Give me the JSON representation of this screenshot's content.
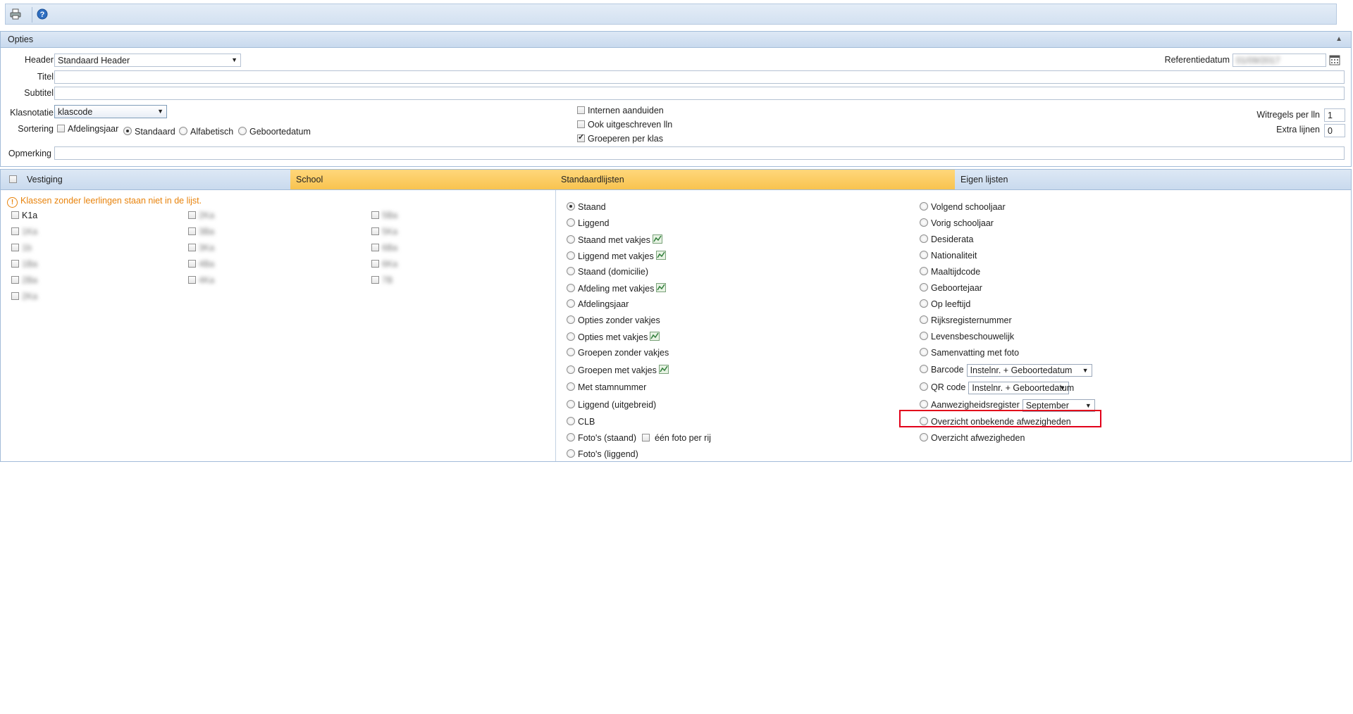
{
  "toolbar": {
    "print_icon": "printer-icon",
    "help_icon": "help-icon"
  },
  "opties": {
    "title": "Opties",
    "collapse_icon": "chevron-up-icon",
    "header_label": "Header",
    "header_value": "Standaard Header",
    "referentiedatum_label": "Referentiedatum",
    "referentiedatum_value": "01/09/2017",
    "titel_label": "Titel",
    "subtitel_label": "Subtitel",
    "klasnotatie_label": "Klasnotatie",
    "klasnotatie_value": "klascode",
    "sortering_label": "Sortering",
    "sort_afdelingsjaar": "Afdelingsjaar",
    "sort_options": [
      "Standaard",
      "Alfabetisch",
      "Geboortedatum"
    ],
    "sort_selected": "Standaard",
    "checks": [
      {
        "label": "Internen aanduiden",
        "checked": false
      },
      {
        "label": "Ook uitgeschreven lln",
        "checked": false
      },
      {
        "label": "Groeperen per klas",
        "checked": true
      }
    ],
    "witregels_label": "Witregels per lln",
    "witregels_value": "1",
    "extra_lijnen_label": "Extra lijnen",
    "extra_lijnen_value": "0",
    "opmerking_label": "Opmerking"
  },
  "tabs": {
    "vestiging": "Vestiging",
    "school": "School",
    "standaardlijsten": "Standaardlijsten",
    "eigen_lijsten": "Eigen lijsten"
  },
  "classes": {
    "warning": "Klassen zonder leerlingen staan niet in de lijst.",
    "col1": [
      "K1a",
      "1Ka",
      "1b",
      "1Ba",
      "2Ba",
      "2Ka"
    ],
    "col2": [
      "2Ka",
      "3Ba",
      "3Ka",
      "4Ba",
      "4Ka"
    ],
    "col3": [
      "5Ba",
      "5Ka",
      "6Ba",
      "6Ka",
      "7B"
    ]
  },
  "standaardlijsten": {
    "items": [
      {
        "label": "Staand",
        "selected": true
      },
      {
        "label": "Liggend"
      },
      {
        "label": "Staand met vakjes",
        "chart": true
      },
      {
        "label": "Liggend met vakjes",
        "chart": true
      },
      {
        "label": "Staand (domicilie)"
      },
      {
        "label": "Afdeling met vakjes",
        "chart": true
      },
      {
        "label": "Afdelingsjaar"
      },
      {
        "label": "Opties zonder vakjes"
      },
      {
        "label": "Opties met vakjes",
        "chart": true
      },
      {
        "label": "Groepen zonder vakjes"
      },
      {
        "label": "Groepen met vakjes",
        "chart": true
      },
      {
        "label": "Met stamnummer"
      },
      {
        "label": "Liggend (uitgebreid)"
      },
      {
        "label": "CLB"
      },
      {
        "label": "Foto's (staand)"
      },
      {
        "label": "Foto's (liggend)"
      }
    ],
    "een_foto_per_rij": "één foto per rij"
  },
  "eigen_lijsten": {
    "items": [
      "Volgend schooljaar",
      "Vorig schooljaar",
      "Desiderata",
      "Nationaliteit",
      "Maaltijdcode",
      "Geboortejaar",
      "Op leeftijd",
      "Rijksregisternummer",
      "Levensbeschouwelijk",
      "Samenvatting met foto",
      "Barcode",
      "QR code",
      "Aanwezigheidsregister",
      "Overzicht onbekende afwezigheden",
      "Overzicht afwezigheden"
    ],
    "barcode_select": "Instelnr. + Geboortedatum",
    "qrcode_select": "Instelnr. + Geboortedatum",
    "aanwezigheid_select": "September"
  },
  "colors": {
    "tab_yellow": "#f8c34f",
    "warning": "#e8830c",
    "highlight": "#e2001a",
    "header_blue": "#c9daee"
  }
}
